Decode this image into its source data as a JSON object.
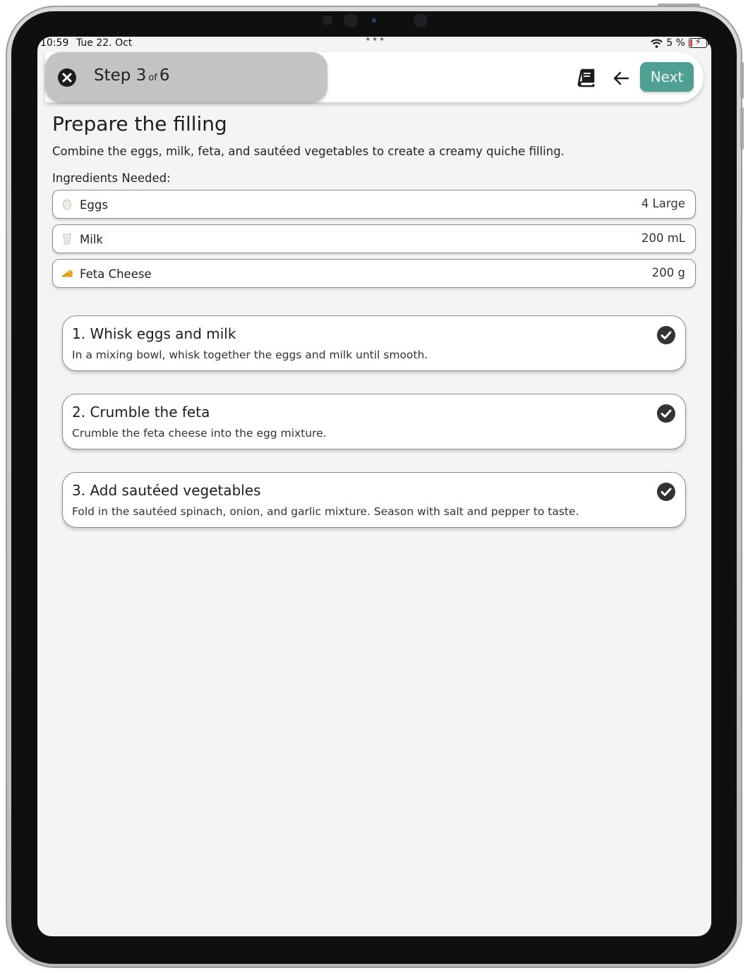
{
  "status_bar": {
    "time": "10:59",
    "date": "Tue 22. Oct",
    "dots": "•••",
    "battery": "5 %"
  },
  "header": {
    "step_word": "Step",
    "current_step": "3",
    "of_word": "of",
    "total_steps": "6",
    "next_label": "Next"
  },
  "colors": {
    "accent": "#4f9f92",
    "step_pill": "#c3c3c3",
    "background": "#f4f4f4"
  },
  "page": {
    "title": "Prepare the filling",
    "description": "Combine the eggs, milk, feta, and sautéed vegetables to create a creamy quiche filling.",
    "ingredients_header": "Ingredients Needed:"
  },
  "ingredients": [
    {
      "icon": "egg-icon",
      "name": "Eggs",
      "quantity": "4 Large"
    },
    {
      "icon": "milk-glass-icon",
      "name": "Milk",
      "quantity": "200 mL"
    },
    {
      "icon": "cheese-icon",
      "name": "Feta Cheese",
      "quantity": "200 g"
    }
  ],
  "steps": [
    {
      "title": "1. Whisk eggs and milk",
      "description": "In a mixing bowl, whisk together the eggs and milk until smooth."
    },
    {
      "title": "2. Crumble the feta",
      "description": "Crumble the feta cheese into the egg mixture."
    },
    {
      "title": "3. Add sautéed vegetables",
      "description": "Fold in the sautéed spinach, onion, and garlic mixture. Season with salt and pepper to taste."
    }
  ]
}
